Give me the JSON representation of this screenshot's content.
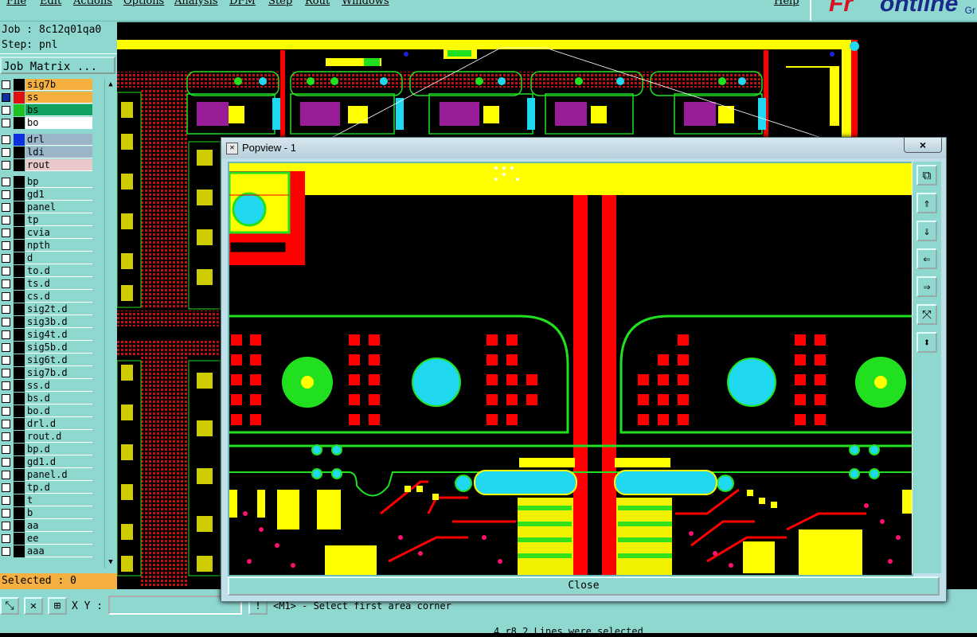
{
  "menu": {
    "items": [
      "File",
      "Edit",
      "Actions",
      "Options",
      "Analysis",
      "DFM",
      "Step",
      "Rout",
      "Windows"
    ],
    "help": "Help"
  },
  "logo": {
    "text_red": "Fr",
    "text_blue": "ontline",
    "tail": "Gr"
  },
  "job": {
    "label": "Job : 8c12q01qa0",
    "step": "Step: pnl"
  },
  "job_matrix_button": "Job Matrix ...",
  "layers": [
    {
      "name": "sig7b",
      "color": "#f5b040",
      "swatch": "#000000"
    },
    {
      "name": "ss",
      "color": "#f5b040",
      "swatch": "#e01010",
      "checked": true
    },
    {
      "name": "bs",
      "color": "#10a060",
      "swatch": "#20c020"
    },
    {
      "name": "bo",
      "color": "#ffffff",
      "swatch": "#000000"
    },
    {
      "name": "drl",
      "color": "#9ab4c8",
      "swatch": "#1030e0"
    },
    {
      "name": "ldi",
      "color": "#9ab4c8",
      "swatch": "#000000"
    },
    {
      "name": "rout",
      "color": "#e8c8c8",
      "swatch": "#000000"
    },
    {
      "name": "bp"
    },
    {
      "name": "gd1"
    },
    {
      "name": "panel"
    },
    {
      "name": "tp"
    },
    {
      "name": "cvia"
    },
    {
      "name": "npth"
    },
    {
      "name": "d"
    },
    {
      "name": "to.d"
    },
    {
      "name": "ts.d"
    },
    {
      "name": "cs.d"
    },
    {
      "name": "sig2t.d"
    },
    {
      "name": "sig3b.d"
    },
    {
      "name": "sig4t.d"
    },
    {
      "name": "sig5b.d"
    },
    {
      "name": "sig6t.d"
    },
    {
      "name": "sig7b.d"
    },
    {
      "name": "ss.d"
    },
    {
      "name": "bs.d"
    },
    {
      "name": "bo.d"
    },
    {
      "name": "drl.d"
    },
    {
      "name": "rout.d"
    },
    {
      "name": "bp.d"
    },
    {
      "name": "gd1.d"
    },
    {
      "name": "panel.d"
    },
    {
      "name": "tp.d"
    },
    {
      "name": "t"
    },
    {
      "name": "b"
    },
    {
      "name": "aa"
    },
    {
      "name": "ee"
    },
    {
      "name": "aaa"
    }
  ],
  "selected_label": "Selected : 0",
  "bottom": {
    "xy_label": "X Y :",
    "xy_value": "",
    "message": "<M1> - Select first area corner",
    "status": "4 r8.2 Lines were selected"
  },
  "popup": {
    "title": "Popview - 1",
    "close_x": "×",
    "close_button": "Close",
    "tools": [
      "window-icon",
      "up-icon",
      "down-icon",
      "left-icon",
      "right-icon",
      "fit-icon",
      "zoom-icon"
    ]
  },
  "colors": {
    "panel_bg": "#8fd8d0",
    "yellow": "#ffff00",
    "red": "#ff0000",
    "green": "#20e020",
    "cyan": "#20d8f0",
    "selected_bar": "#f5b040"
  }
}
